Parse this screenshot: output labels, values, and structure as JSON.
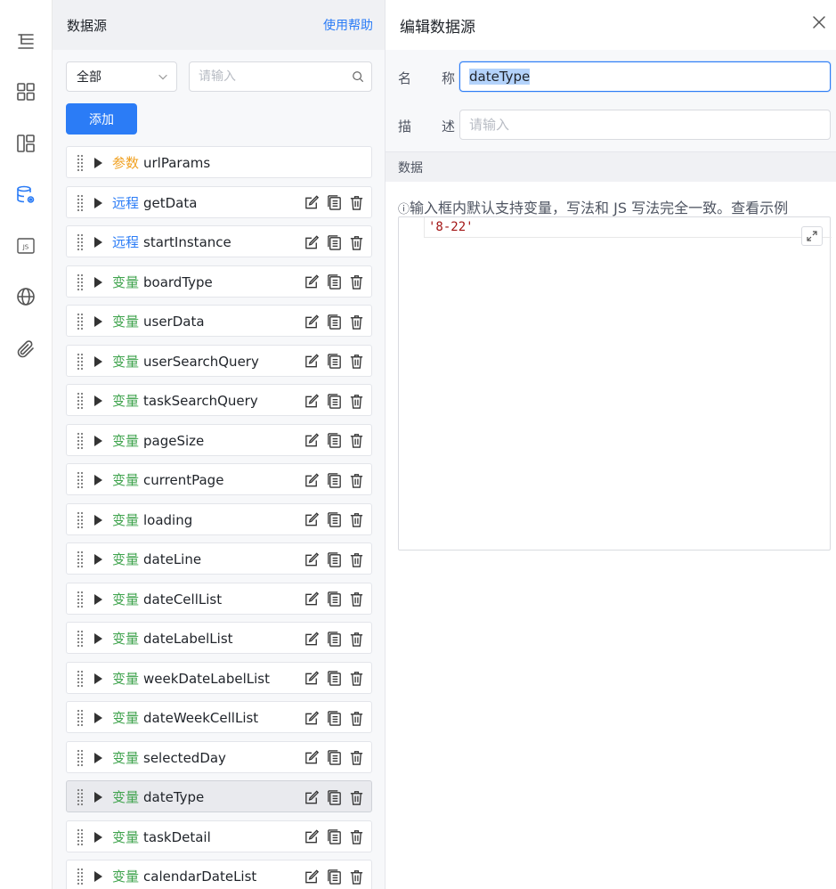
{
  "rail": {
    "icons": [
      "outline-icon",
      "components-icon",
      "layout-icon",
      "datasource-icon",
      "js-icon",
      "i18n-globe-icon",
      "attachment-icon"
    ],
    "active": "datasource-icon",
    "js_label": "JS"
  },
  "datasource": {
    "title": "数据源",
    "help_label": "使用帮助",
    "filter_value": "全部",
    "search_placeholder": "请输入",
    "add_label": "添加",
    "items": [
      {
        "type": "参数",
        "kind": "param",
        "name": "urlParams",
        "actions": false
      },
      {
        "type": "远程",
        "kind": "remote",
        "name": "getData",
        "actions": true
      },
      {
        "type": "远程",
        "kind": "remote",
        "name": "startInstance",
        "actions": true
      },
      {
        "type": "变量",
        "kind": "var",
        "name": "boardType",
        "actions": true
      },
      {
        "type": "变量",
        "kind": "var",
        "name": "userData",
        "actions": true
      },
      {
        "type": "变量",
        "kind": "var",
        "name": "userSearchQuery",
        "actions": true
      },
      {
        "type": "变量",
        "kind": "var",
        "name": "taskSearchQuery",
        "actions": true
      },
      {
        "type": "变量",
        "kind": "var",
        "name": "pageSize",
        "actions": true
      },
      {
        "type": "变量",
        "kind": "var",
        "name": "currentPage",
        "actions": true
      },
      {
        "type": "变量",
        "kind": "var",
        "name": "loading",
        "actions": true
      },
      {
        "type": "变量",
        "kind": "var",
        "name": "dateLine",
        "actions": true
      },
      {
        "type": "变量",
        "kind": "var",
        "name": "dateCellList",
        "actions": true
      },
      {
        "type": "变量",
        "kind": "var",
        "name": "dateLabelList",
        "actions": true
      },
      {
        "type": "变量",
        "kind": "var",
        "name": "weekDateLabelList",
        "actions": true
      },
      {
        "type": "变量",
        "kind": "var",
        "name": "dateWeekCellList",
        "actions": true
      },
      {
        "type": "变量",
        "kind": "var",
        "name": "selectedDay",
        "actions": true
      },
      {
        "type": "变量",
        "kind": "var",
        "name": "dateType",
        "actions": true,
        "selected": true
      },
      {
        "type": "变量",
        "kind": "var",
        "name": "taskDetail",
        "actions": true
      },
      {
        "type": "变量",
        "kind": "var",
        "name": "calendarDateList",
        "actions": true
      }
    ]
  },
  "editor": {
    "title": "编辑数据源",
    "name_label_a": "名",
    "name_label_b": "称",
    "name_value": "dateType",
    "desc_label_a": "描",
    "desc_label_b": "述",
    "desc_placeholder": "请输入",
    "section_label": "数据",
    "hint_text": "输入框内默认支持变量，写法和 JS 写法完全一致。",
    "hint_link": "查看示例",
    "code_value": "'8-22'"
  },
  "colors": {
    "accent": "#2b7cf6",
    "param": "#f0a020",
    "remote": "#2b7cf6",
    "var": "#3fa34d"
  }
}
